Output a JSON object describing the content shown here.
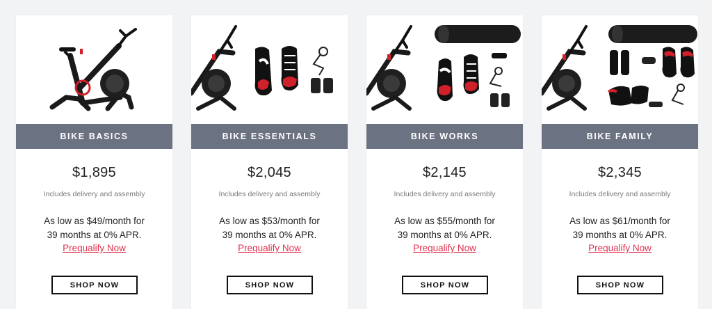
{
  "cards": [
    {
      "title": "BIKE BASICS",
      "price": "$1,895",
      "note": "Includes delivery and assembly",
      "financing_line1": "As low as $49/month for",
      "financing_line2": "39 months at 0% APR.",
      "prequalify": "Prequalify Now",
      "cta": "SHOP NOW",
      "image": "bike-icon"
    },
    {
      "title": "BIKE ESSENTIALS",
      "price": "$2,045",
      "note": "Includes delivery and assembly",
      "financing_line1": "As low as $53/month for",
      "financing_line2": "39 months at 0% APR.",
      "prequalify": "Prequalify Now",
      "cta": "SHOP NOW",
      "image": "bike-with-shoes-weights-icon"
    },
    {
      "title": "BIKE WORKS",
      "price": "$2,145",
      "note": "Includes delivery and assembly",
      "financing_line1": "As low as $55/month for",
      "financing_line2": "39 months at 0% APR.",
      "prequalify": "Prequalify Now",
      "cta": "SHOP NOW",
      "image": "bike-with-mat-shoes-weights-icon"
    },
    {
      "title": "BIKE FAMILY",
      "price": "$2,345",
      "note": "Includes delivery and assembly",
      "financing_line1": "As low as $61/month for",
      "financing_line2": "39 months at 0% APR.",
      "prequalify": "Prequalify Now",
      "cta": "SHOP NOW",
      "image": "bike-with-mat-two-shoes-weights-icon"
    }
  ],
  "colors": {
    "banner": "#6b7281",
    "link": "#e0304d",
    "background": "#f2f3f5"
  }
}
